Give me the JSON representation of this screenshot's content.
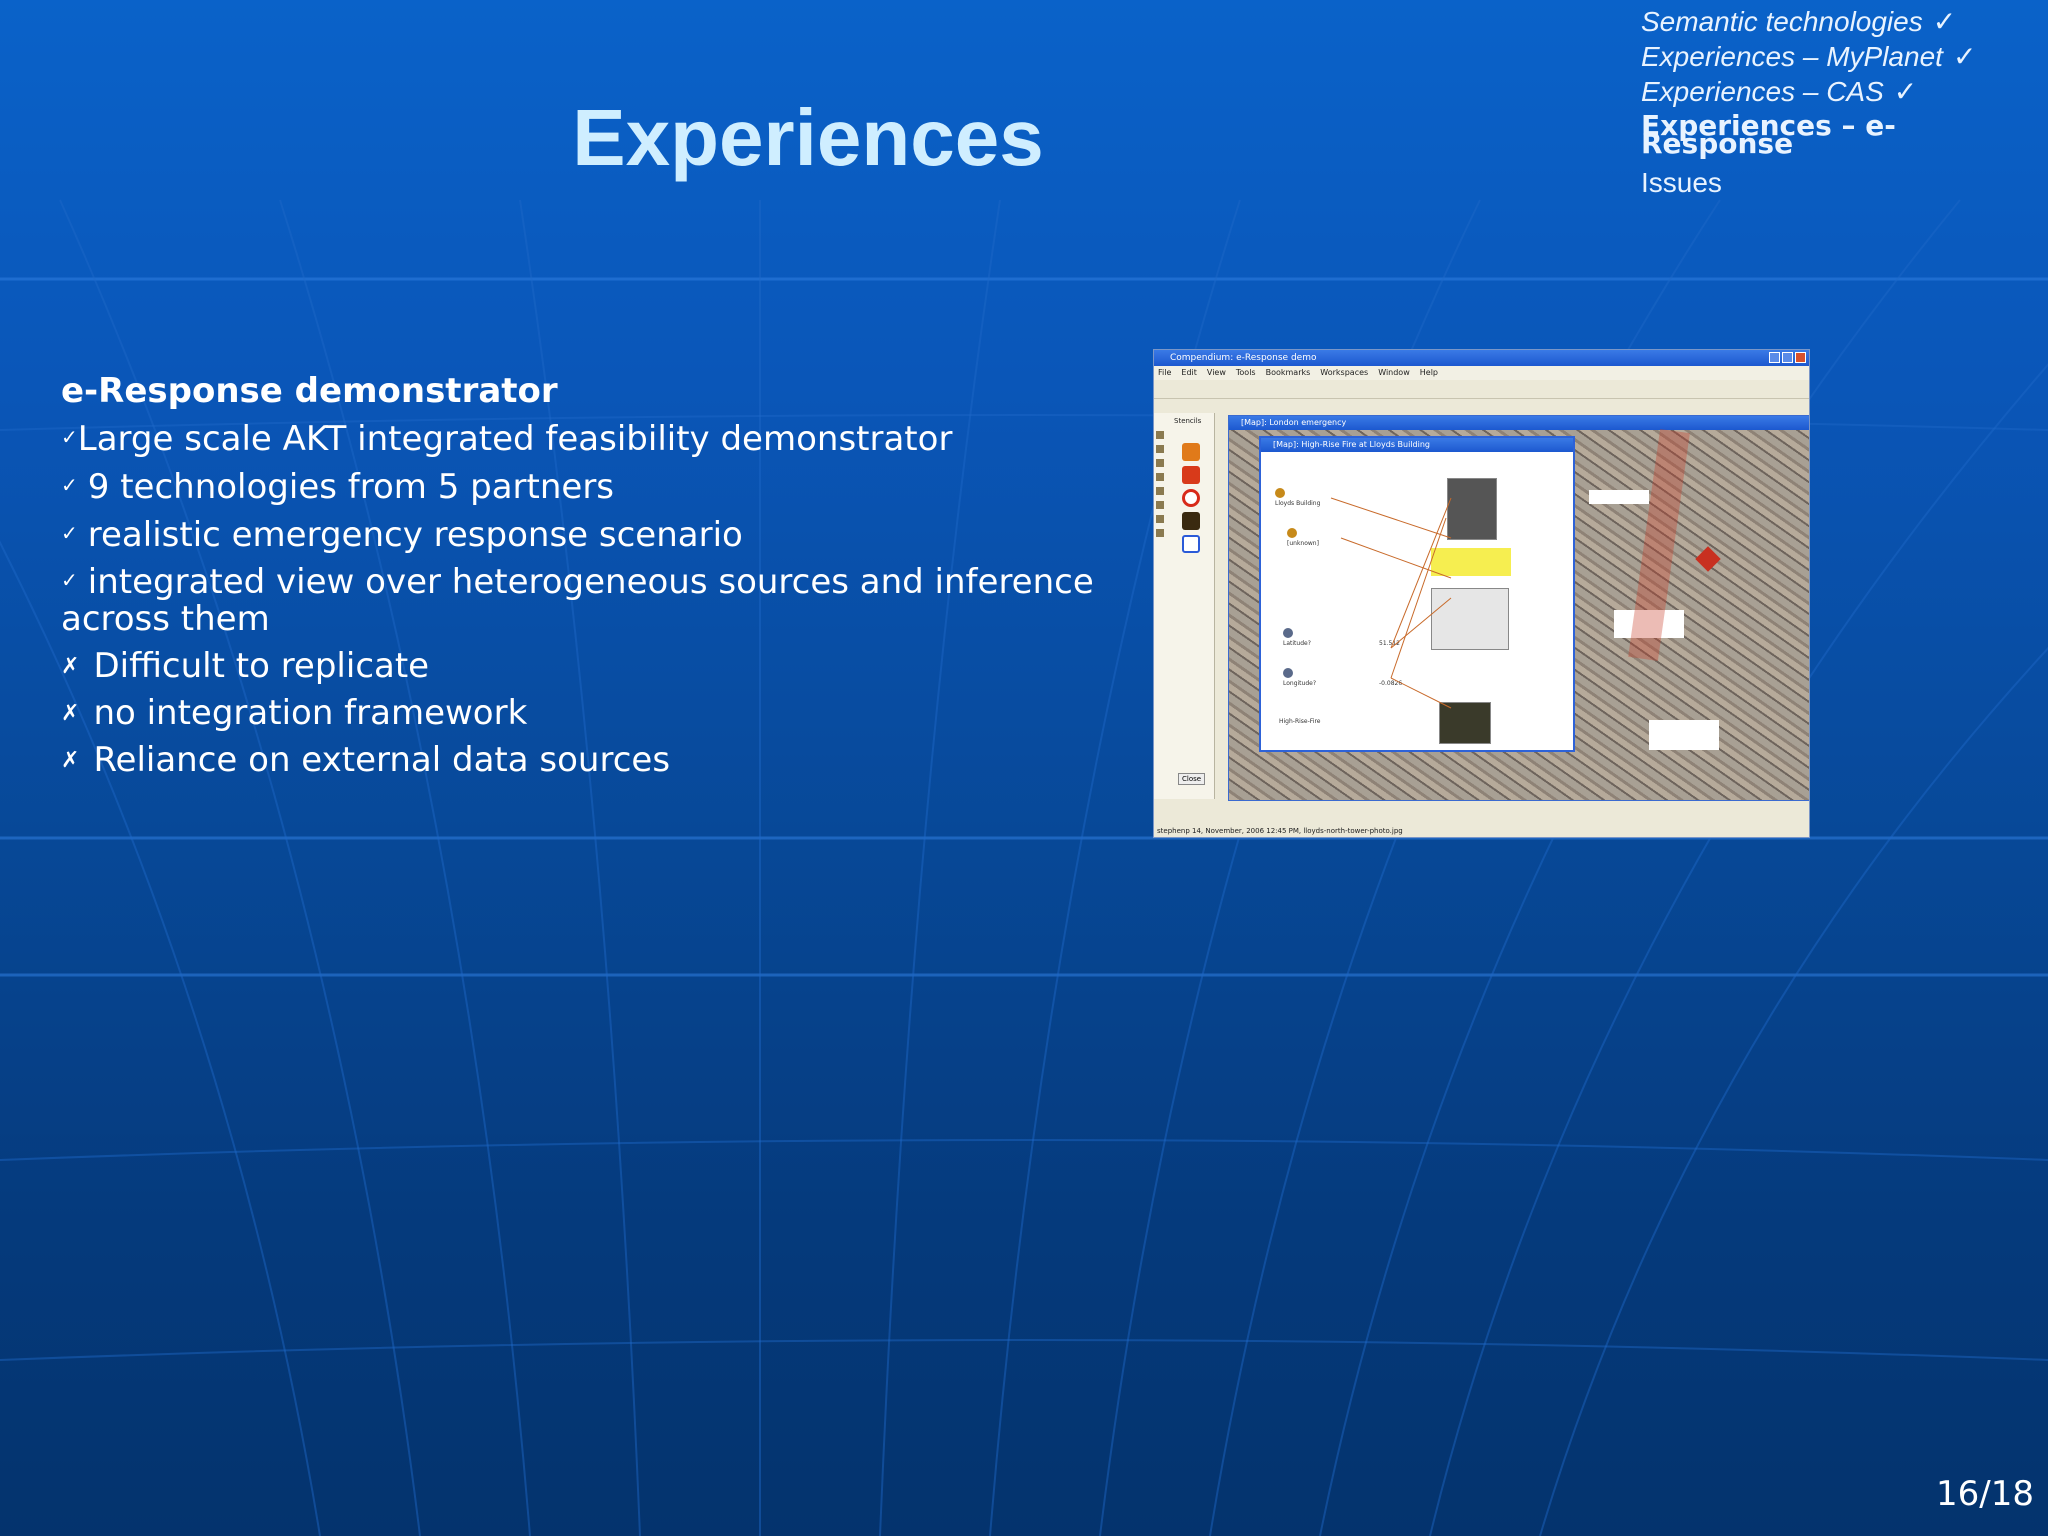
{
  "slide": {
    "title": "Experiences",
    "page_number": "16/18"
  },
  "nav": {
    "items": [
      {
        "label": "Semantic technologies",
        "check": "✓"
      },
      {
        "label": "Experiences –  MyPlanet",
        "check": "✓"
      },
      {
        "label": "Experiences –  CAS",
        "check": "✓"
      },
      {
        "label": "Experiences – e-Response"
      },
      {
        "label": "Issues"
      }
    ]
  },
  "content": {
    "heading": "e-Response demonstrator",
    "check_mark": "✓",
    "cross_mark": "✗",
    "bullets": [
      "Large scale AKT integrated feasibility demonstrator",
      "9 technologies from 5 partners",
      "realistic emergency response scenario",
      "integrated view over heterogeneous sources and inference across them",
      "Difficult to replicate",
      "no integration framework",
      "Reliance on external data sources"
    ]
  },
  "screenshot": {
    "app_title": "Compendium: e-Response demo",
    "menu": [
      "File",
      "Edit",
      "View",
      "Tools",
      "Bookmarks",
      "Workspaces",
      "Window",
      "Help"
    ],
    "stencil_tab": "Stencils",
    "map_title": "[Map]: London emergency",
    "inner_title": "[Map]: High-Rise Fire at Lloyds Building",
    "nodes": [
      "Lloyds Building",
      "[unknown]",
      "Latitude?",
      "Longitude?",
      "High-Rise-Fire",
      "51.512",
      "-0.0826"
    ],
    "close_label": "Close",
    "status": "stephenp 14, November, 2006 12:45 PM, lloyds-north-tower-photo.jpg"
  }
}
